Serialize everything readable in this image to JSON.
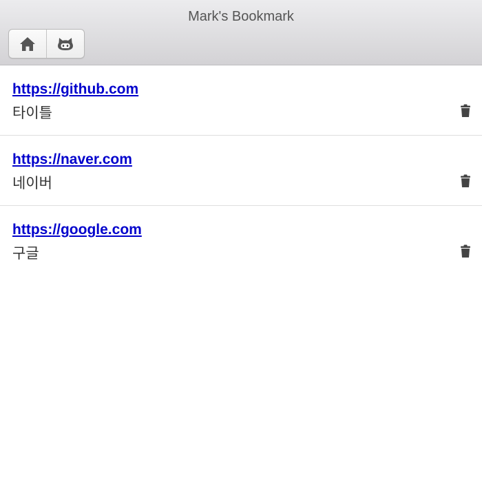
{
  "header": {
    "title": "Mark's Bookmark",
    "buttons": [
      {
        "icon": "home-icon"
      },
      {
        "icon": "github-icon"
      }
    ]
  },
  "bookmarks": [
    {
      "url": "https://github.com",
      "title": "타이틀",
      "delete_icon": "trash-icon"
    },
    {
      "url": "https://naver.com",
      "title": "네이버",
      "delete_icon": "trash-icon"
    },
    {
      "url": "https://google.com",
      "title": "구글",
      "delete_icon": "trash-icon"
    }
  ],
  "colors": {
    "link": "#0000cc",
    "text": "#333333",
    "icon": "#444444",
    "header_top": "#ececee",
    "header_bottom": "#d3d2d5"
  }
}
